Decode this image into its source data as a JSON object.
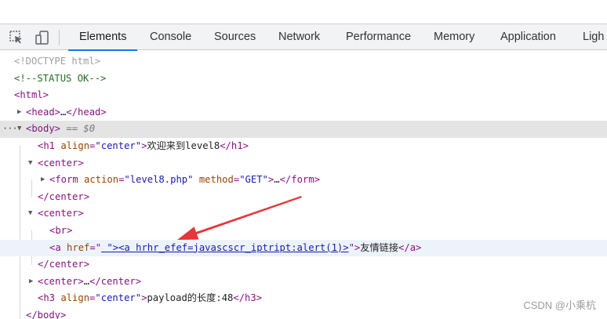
{
  "toolbar": {
    "tabs": [
      {
        "label": "Elements",
        "active": true
      },
      {
        "label": "Console"
      },
      {
        "label": "Sources"
      },
      {
        "label": "Network"
      },
      {
        "label": "Performance"
      },
      {
        "label": "Memory"
      },
      {
        "label": "Application"
      },
      {
        "label": "Ligh"
      }
    ],
    "icons": [
      "inspect-element-icon",
      "device-toolbar-icon"
    ]
  },
  "tree": {
    "doctype": "<!DOCTYPE html>",
    "comment": "<!--STATUS OK-->",
    "html_open": "<html>",
    "head": {
      "open": "<head>",
      "ellipsis": "…",
      "close": "</head>"
    },
    "body": {
      "open": "<body>",
      "console_ref": " == $0",
      "dots": "···"
    },
    "h1": {
      "tag_open": "<h1",
      "attr": "align",
      "eq": "=",
      "val": "\"center\"",
      "gt": ">",
      "text": "欢迎来到level8",
      "close": "</h1>"
    },
    "center1": {
      "open": "<center>",
      "close": "</center>"
    },
    "form": {
      "tag_open": "<form",
      "attr1": "action",
      "val1": "\"level8.php\"",
      "attr2": "method",
      "val2": "\"GET\"",
      "gt": ">",
      "ellipsis": "…",
      "close": "</form>"
    },
    "center2": {
      "open": "<center>",
      "close": "</center>"
    },
    "br": "<br>",
    "anchor": {
      "tag_open": "<a",
      "attr": "href",
      "quote_open": "=\"",
      "val": " \"><a hrhr_efef=javascscr_iptript:alert(1)>",
      "quote_close": "\">",
      "text": "友情链接",
      "close": "</a>"
    },
    "center3": {
      "open": "<center>",
      "ellipsis": "…",
      "close": "</center>"
    },
    "h3": {
      "tag_open": "<h3",
      "attr": "align",
      "eq": "=",
      "val": "\"center\"",
      "gt": ">",
      "text": "payload的长度:48",
      "close": "</h3>"
    },
    "body_close": "</body>"
  },
  "watermark": "CSDN @小乘杭",
  "colors": {
    "tag": "#881280",
    "attr_name": "#994500",
    "attr_value": "#1a1aa6",
    "comment": "#236e25",
    "active_tab_underline": "#1a73e8",
    "arrow": "#e8363b"
  }
}
